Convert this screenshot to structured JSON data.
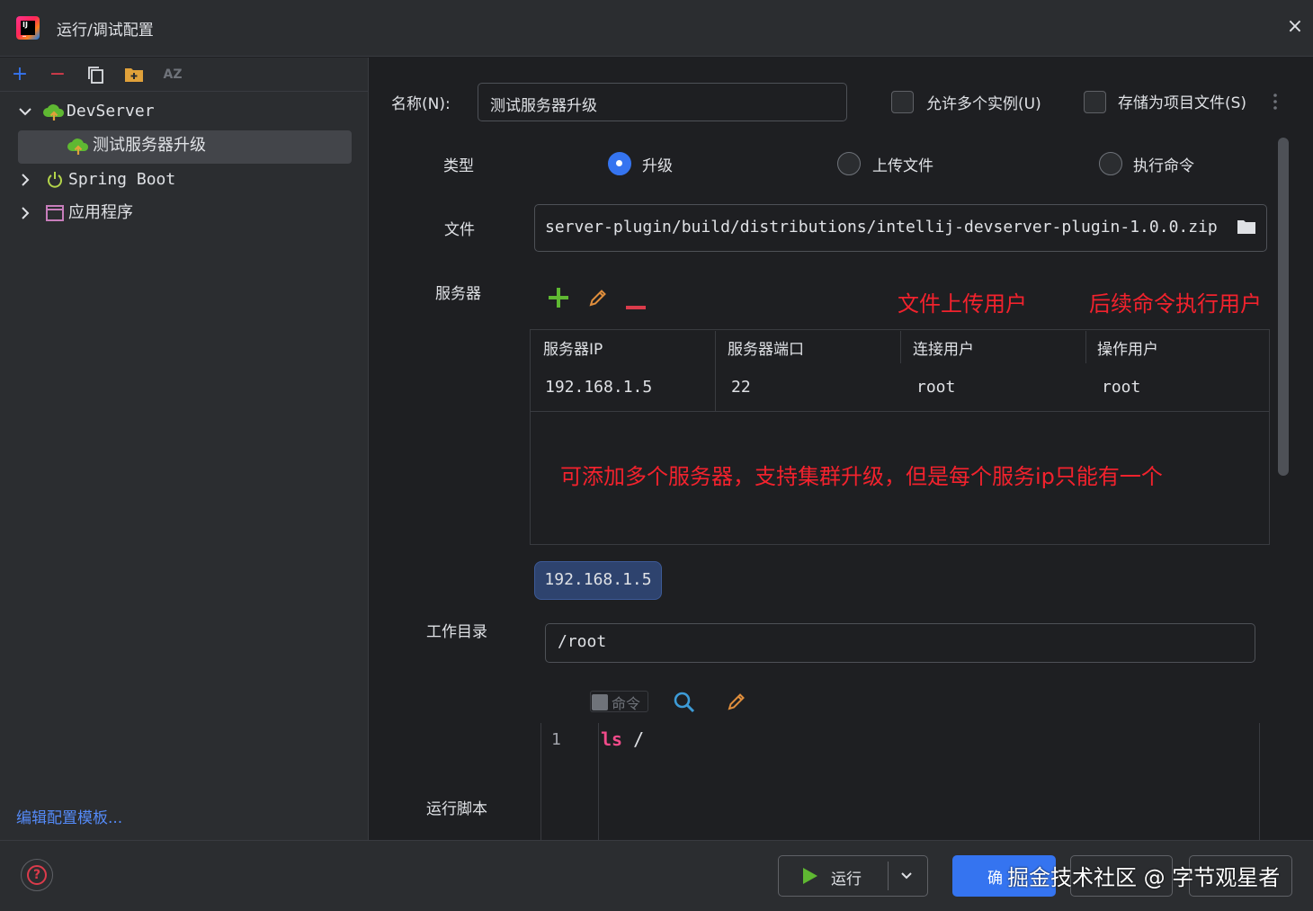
{
  "window": {
    "title": "运行/调试配置",
    "close_icon": "×"
  },
  "sidebar": {
    "toolbar": {
      "add": "+",
      "remove": "−",
      "sort": "AZ"
    },
    "tree": [
      {
        "label": "DevServer",
        "expanded": true
      },
      {
        "label": "测试服务器升级",
        "selected": true
      },
      {
        "label": "Spring Boot",
        "expanded": false
      },
      {
        "label": "应用程序",
        "expanded": false
      }
    ],
    "edit_templates": "编辑配置模板..."
  },
  "form": {
    "name_label": "名称(N):",
    "name_value": "测试服务器升级",
    "allow_multiple": {
      "label": "允许多个实例(U)",
      "checked": false
    },
    "store_as_file": {
      "label": "存储为项目文件(S)",
      "checked": false
    },
    "type_label": "类型",
    "type_options": [
      {
        "label": "升级",
        "selected": true
      },
      {
        "label": "上传文件",
        "selected": false
      },
      {
        "label": "执行命令",
        "selected": false
      }
    ],
    "file_label": "文件",
    "file_value": "server-plugin/build/distributions/intellij-devserver-plugin-1.0.0.zip",
    "servers_label": "服务器",
    "annotation_upload_user": "文件上传用户",
    "annotation_exec_user": "后续命令执行用户",
    "servers_table": {
      "headers": [
        "服务器IP",
        "服务器端口",
        "连接用户",
        "操作用户"
      ],
      "rows": [
        [
          "192.168.1.5",
          "22",
          "root",
          "root"
        ]
      ]
    },
    "annotation_cluster": "可添加多个服务器，支持集群升级，但是每个服务ip只能有一个",
    "selected_server_chip": "192.168.1.5",
    "workdir_label": "工作目录",
    "workdir_value": "/root",
    "command_checkbox_label": "命令",
    "script_label": "运行脚本",
    "script": {
      "line_number": "1",
      "keyword": "ls",
      "arg": " /"
    }
  },
  "footer": {
    "help": "?",
    "run_label": "运行",
    "ok_label_partial": "确",
    "watermark": "掘金技术社区 @ 字节观星者"
  },
  "colors": {
    "accent": "#3574f0",
    "annotation_red": "#f2222d",
    "green_add": "#5fb832",
    "red_remove": "#db3b4b",
    "pencil": "#e08e3c",
    "search": "#3d9bd7"
  }
}
